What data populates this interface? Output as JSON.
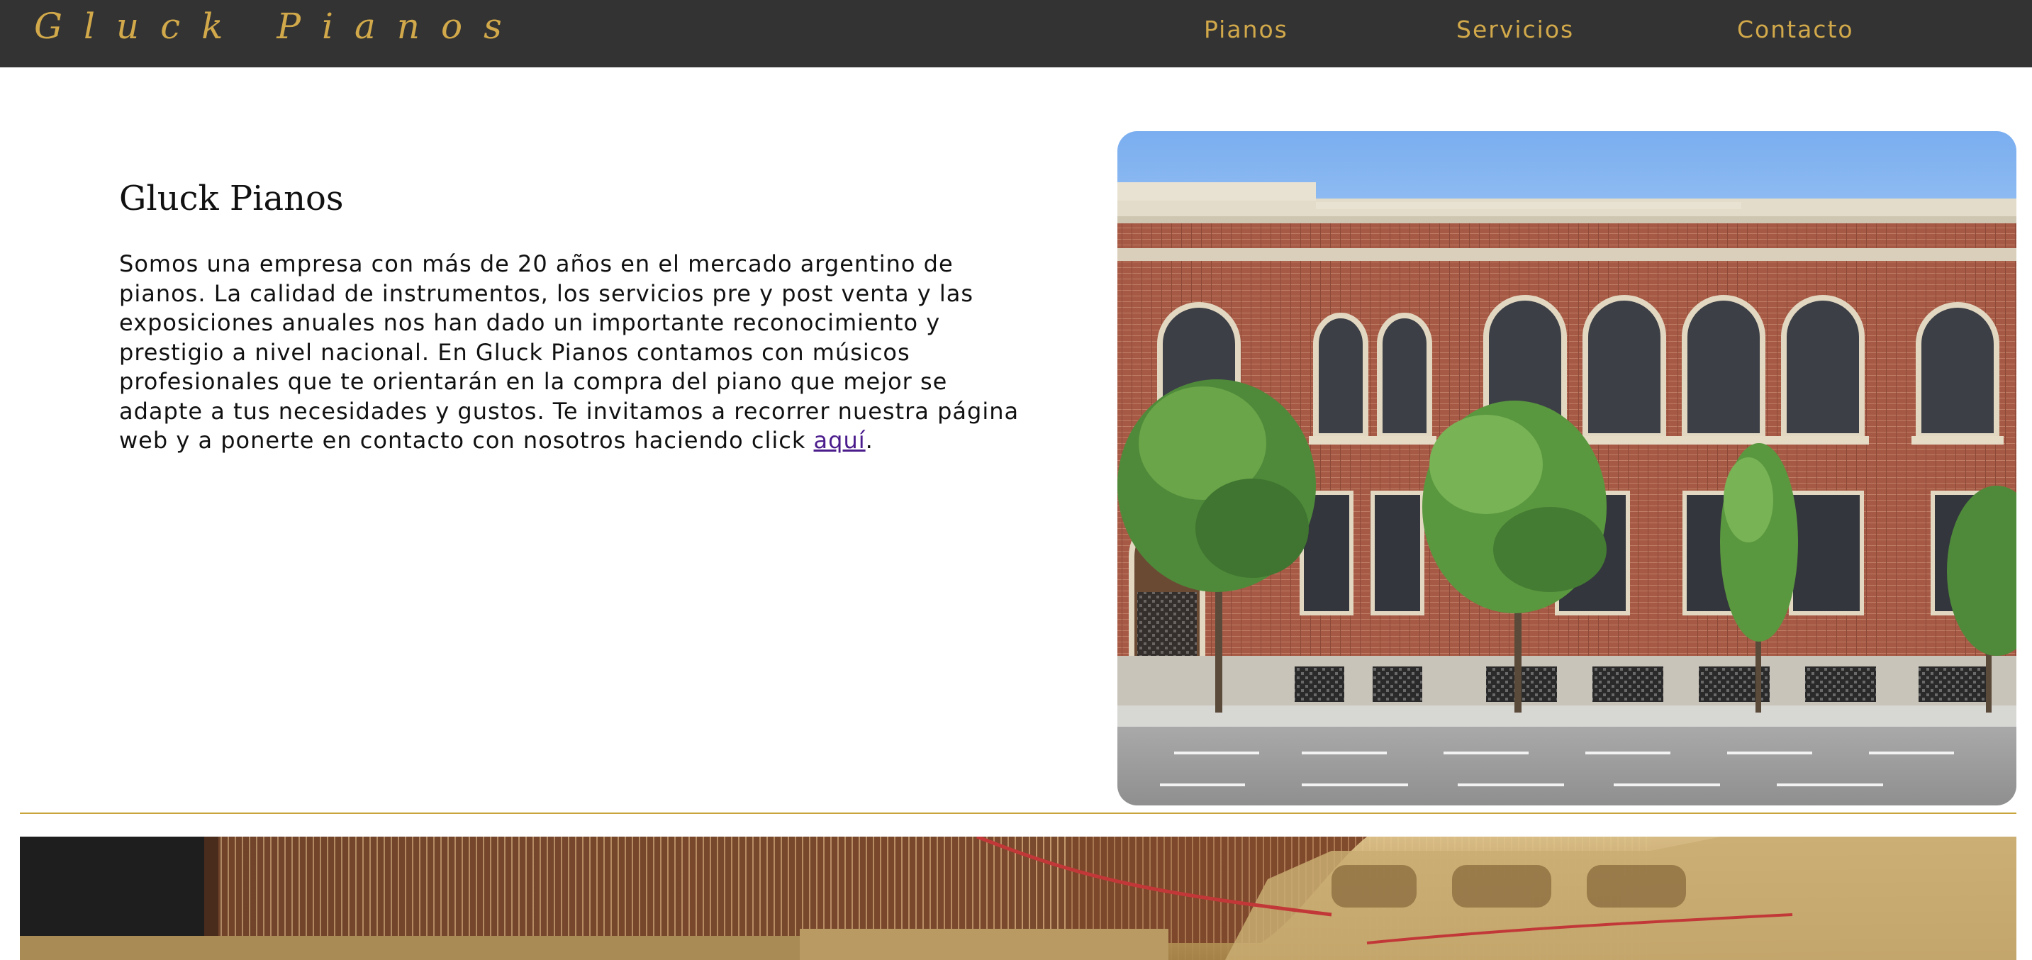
{
  "nav": {
    "logo": "Gluck Pianos",
    "links": [
      {
        "label": "Pianos"
      },
      {
        "label": "Servicios"
      },
      {
        "label": "Contacto"
      }
    ]
  },
  "intro": {
    "title": "Gluck Pianos",
    "body": "Somos una empresa con más de 20 años en el mercado argentino de pianos. La calidad de instrumentos, los servicios pre y post venta y las exposiciones anuales nos han dado un importante reconocimiento y prestigio a nivel nacional. En Gluck Pianos contamos con músicos profesionales que te orientarán en la compra del piano que mejor se adapte a tus necesidades y gustos. Te invitamos a recorrer nuestra página web y a ponerte en contacto con nosotros haciendo click ",
    "link_label": "aquí",
    "trailing": "."
  },
  "colors": {
    "nav_bg": "#333333",
    "accent_gold": "#d2a94a",
    "divider": "#c9a43a",
    "link": "#4b1c8c"
  }
}
